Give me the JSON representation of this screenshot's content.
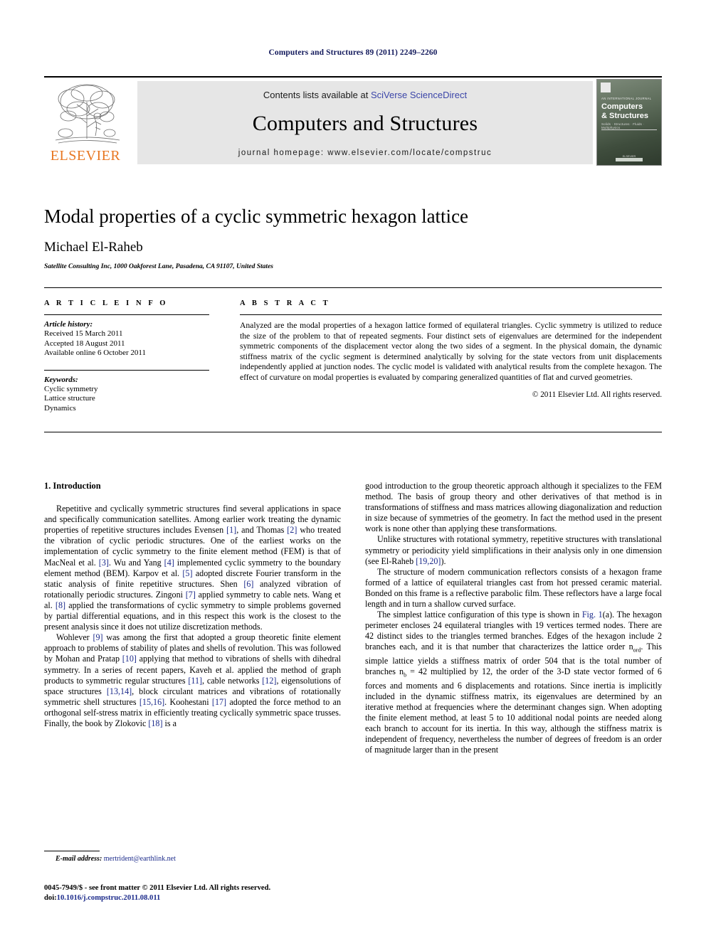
{
  "running_head": "Computers and Structures 89 (2011) 2249–2260",
  "masthead": {
    "contents_prefix": "Contents lists available at ",
    "sciencedirect": "SciVerse ScienceDirect",
    "journal_title": "Computers and Structures",
    "homepage": "journal homepage: www.elsevier.com/locate/compstruc",
    "publisher_wordmark": "ELSEVIER",
    "cover": {
      "supertext": "AN INTERNATIONAL JOURNAL",
      "name_line1": "Computers",
      "name_line2": "& Structures",
      "subtitle": "Solids · Structures · Fluids · Multiphysics",
      "footer": "ELSEVIER"
    },
    "link_color": "#3b45a8",
    "band_color": "#e6e6e6",
    "elsevier_orange": "#e87722"
  },
  "article": {
    "title": "Modal properties of a cyclic symmetric hexagon lattice",
    "author": "Michael El-Raheb",
    "affiliation": "Satellite Consulting Inc, 1000 Oakforest Lane, Pasadena, CA 91107, United States"
  },
  "article_info": {
    "heading": "A R T I C L E    I N F O",
    "history_label": "Article history:",
    "history": [
      "Received 15 March 2011",
      "Accepted 18 August 2011",
      "Available online 6 October 2011"
    ],
    "keywords_label": "Keywords:",
    "keywords": [
      "Cyclic symmetry",
      "Lattice structure",
      "Dynamics"
    ]
  },
  "abstract": {
    "heading": "A B S T R A C T",
    "text": "Analyzed are the modal properties of a hexagon lattice formed of equilateral triangles. Cyclic symmetry is utilized to reduce the size of the problem to that of repeated segments. Four distinct sets of eigenvalues are determined for the independent symmetric components of the displacement vector along the two sides of a segment. In the physical domain, the dynamic stiffness matrix of the cyclic segment is determined analytically by solving for the state vectors from unit displacements independently applied at junction nodes. The cyclic model is validated with analytical results from the complete hexagon. The effect of curvature on modal properties is evaluated by comparing generalized quantities of flat and curved geometries.",
    "copyright": "© 2011 Elsevier Ltd. All rights reserved."
  },
  "body": {
    "section_title": "1. Introduction",
    "left_paragraphs": [
      "Repetitive and cyclically symmetric structures find several applications in space and specifically communication satellites. Among earlier work treating the dynamic properties of repetitive structures includes Evensen [1], and Thomas [2] who treated the vibration of cyclic periodic structures. One of the earliest works on the implementation of cyclic symmetry to the finite element method (FEM) is that of MacNeal et al. [3]. Wu and Yang [4] implemented cyclic symmetry to the boundary element method (BEM). Karpov et al. [5] adopted discrete Fourier transform in the static analysis of finite repetitive structures. Shen [6] analyzed vibration of rotationally periodic structures. Zingoni [7] applied symmetry to cable nets. Wang et al. [8] applied the transformations of cyclic symmetry to simple problems governed by partial differential equations, and in this respect this work is the closest to the present analysis since it does not utilize discretization methods.",
      "Wohlever [9] was among the first that adopted a group theoretic finite element approach to problems of stability of plates and shells of revolution. This was followed by Mohan and Pratap [10] applying that method to vibrations of shells with dihedral symmetry. In a series of recent papers, Kaveh et al. applied the method of graph products to symmetric regular structures [11], cable networks [12], eigensolutions of space structures [13,14], block circulant matrices and vibrations of rotationally symmetric shell structures [15,16]. Koohestani [17] adopted the force method to an orthogonal self-stress matrix in efficiently treating cyclically symmetric space trusses. Finally, the book by Zlokovic [18] is a"
    ],
    "right_paragraphs": [
      "good introduction to the group theoretic approach although it specializes to the FEM method. The basis of group theory and other derivatives of that method is in transformations of stiffness and mass matrices allowing diagonalization and reduction in size because of symmetries of the geometry. In fact the method used in the present work is none other than applying these transformations.",
      "Unlike structures with rotational symmetry, repetitive structures with translational symmetry or periodicity yield simplifications in their analysis only in one dimension (see El-Raheb [19,20]).",
      "The structure of modern communication reflectors consists of a hexagon frame formed of a lattice of equilateral triangles cast from hot pressed ceramic material. Bonded on this frame is a reflective parabolic film. These reflectors have a large focal length and in turn a shallow curved surface.",
      "The simplest lattice configuration of this type is shown in Fig. 1(a). The hexagon perimeter encloses 24 equilateral triangles with 19 vertices termed nodes. There are 42 distinct sides to the triangles termed branches. Edges of the hexagon include 2 branches each, and it is that number that characterizes the lattice order nord. This simple lattice yields a stiffness matrix of order 504 that is the total number of branches nb = 42 multiplied by 12, the order of the 3-D state vector formed of 6 forces and moments and 6 displacements and rotations. Since inertia is implicitly included in the dynamic stiffness matrix, its eigenvalues are determined by an iterative method at frequencies where the determinant changes sign. When adopting the finite element method, at least 5 to 10 additional nodal points are needed along each branch to account for its inertia. In this way, although the stiffness matrix is independent of frequency, nevertheless the number of degrees of freedom is an order of magnitude larger than in the present"
    ]
  },
  "footer": {
    "email_label": "E-mail address:",
    "email": "mertrident@earthlink.net",
    "issn_line": "0045-7949/$ - see front matter © 2011 Elsevier Ltd. All rights reserved.",
    "doi_label": "doi:",
    "doi": "10.1016/j.compstruc.2011.08.011"
  }
}
